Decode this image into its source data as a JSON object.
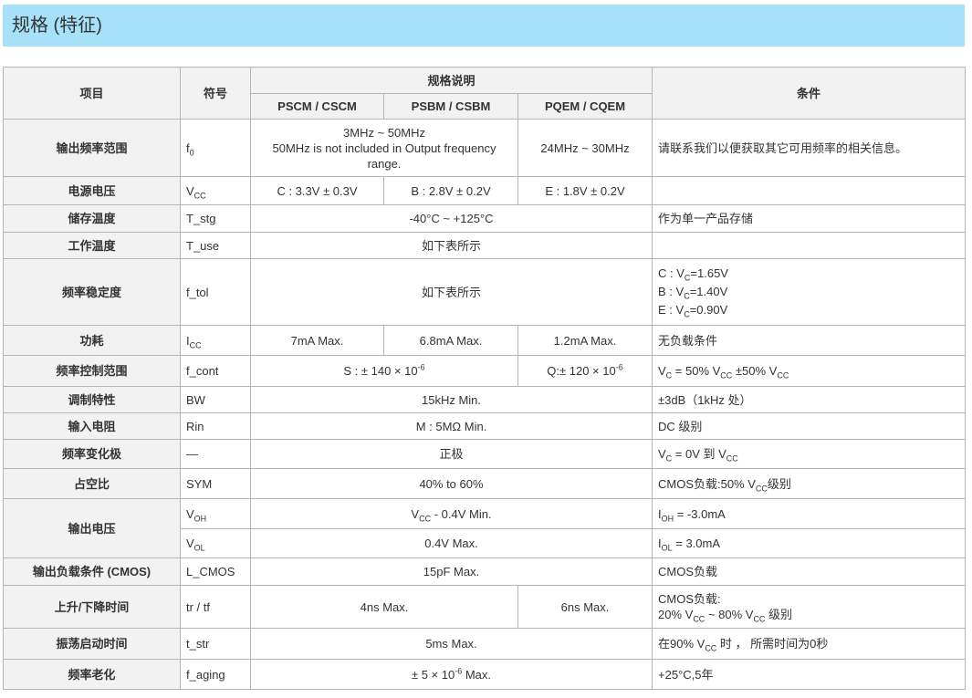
{
  "page": {
    "title": "规格 (特征)"
  },
  "table": {
    "headers": {
      "item": "项目",
      "symbol": "符号",
      "spec": "规格说明",
      "condition": "条件",
      "col1": "PSCM / CSCM",
      "col2": "PSBM / CSBM",
      "col3": "PQEM / CQEM"
    },
    "rows": {
      "freq_range": {
        "item": "输出频率范围",
        "sym_main": "f",
        "sym_sub": "0",
        "v12_line1": "3MHz ~ 50MHz",
        "v12_line2": "50MHz is not included in Output frequency range.",
        "v3": "24MHz ~ 30MHz",
        "cond": "请联系我们以便获取其它可用频率的相关信息。"
      },
      "supply_voltage": {
        "item": "电源电压",
        "sym_main": "V",
        "sym_sub": "CC",
        "v1": "C : 3.3V ± 0.3V",
        "v2": "B : 2.8V ± 0.2V",
        "v3": "E : 1.8V ± 0.2V",
        "cond": ""
      },
      "storage_temp": {
        "item": "储存温度",
        "sym": "T_stg",
        "v": "-40°C ~ +125°C",
        "cond": "作为单一产品存储"
      },
      "operating_temp": {
        "item": "工作温度",
        "sym": "T_use",
        "v": "如下表所示",
        "cond": ""
      },
      "freq_tolerance": {
        "item": "频率稳定度",
        "sym": "f_tol",
        "v": "如下表所示",
        "cond_c_pre": "C : V",
        "cond_c_sub": "C",
        "cond_c_post": "=1.65V",
        "cond_b_pre": "B : V",
        "cond_b_sub": "C",
        "cond_b_post": "=1.40V",
        "cond_e_pre": "E : V",
        "cond_e_sub": "C",
        "cond_e_post": "=0.90V"
      },
      "current": {
        "item": "功耗",
        "sym_main": "I",
        "sym_sub": "CC",
        "v1": "7mA Max.",
        "v2": "6.8mA Max.",
        "v3": "1.2mA Max.",
        "cond": "无负载条件"
      },
      "freq_control": {
        "item": "频率控制范围",
        "sym": "f_cont",
        "v12_pre": "S : ± 140 × 10",
        "v12_sup": "-6",
        "v3_pre": "Q:± 120 × 10",
        "v3_sup": "-6",
        "cond_p1": "V",
        "cond_s1": "C",
        "cond_p2": " = 50% V",
        "cond_s2": "CC",
        "cond_p3": " ±50% V",
        "cond_s3": "CC"
      },
      "modulation": {
        "item": "调制特性",
        "sym": "BW",
        "v": "15kHz Min.",
        "cond": "±3dB（1kHz 处）"
      },
      "input_impedance": {
        "item": "输入电阻",
        "sym": "Rin",
        "v": "M : 5MΩ Min.",
        "cond": "DC 级别"
      },
      "polarity": {
        "item": "频率变化极",
        "sym": "—",
        "v": "正极",
        "cond_p1": "V",
        "cond_s1": "C",
        "cond_p2": " = 0V 到 V",
        "cond_s2": "CC"
      },
      "symmetry": {
        "item": "占空比",
        "sym": "SYM",
        "v": "40% to 60%",
        "cond_p1": "CMOS负载:50% V",
        "cond_s1": "CC",
        "cond_p2": "级别"
      },
      "output_voltage": {
        "item": "输出电压",
        "voh_sym_main": "V",
        "voh_sym_sub": "OH",
        "voh_v_main": "V",
        "voh_v_sub": "CC",
        "voh_v_post": " - 0.4V Min.",
        "voh_cond_main": "I",
        "voh_cond_sub": "OH",
        "voh_cond_post": " = -3.0mA",
        "vol_sym_main": "V",
        "vol_sym_sub": "OL",
        "vol_v": "0.4V Max.",
        "vol_cond_main": "I",
        "vol_cond_sub": "OL",
        "vol_cond_post": " = 3.0mA"
      },
      "output_load": {
        "item": "输出负载条件 (CMOS)",
        "sym": "L_CMOS",
        "v": "15pF Max.",
        "cond": "CMOS负载"
      },
      "rise_fall": {
        "item": "上升/下降时间",
        "sym": "tr / tf",
        "v12": "4ns Max.",
        "v3": "6ns Max.",
        "cond_line1": "CMOS负载:",
        "cond_p1": "20% V",
        "cond_s1": "CC",
        "cond_p2": " ~ 80% V",
        "cond_s2": "CC",
        "cond_p3": " 级别"
      },
      "startup": {
        "item": "振荡启动时间",
        "sym": "t_str",
        "v": "5ms Max.",
        "cond_p1": "在90% V",
        "cond_s1": "CC",
        "cond_p2": " 时 ， 所需时间为0秒"
      },
      "aging": {
        "item": "频率老化",
        "sym": "f_aging",
        "v_pre": "± 5 × 10",
        "v_sup": "-6",
        "v_post": " Max.",
        "cond": "+25°C,5年"
      }
    }
  }
}
